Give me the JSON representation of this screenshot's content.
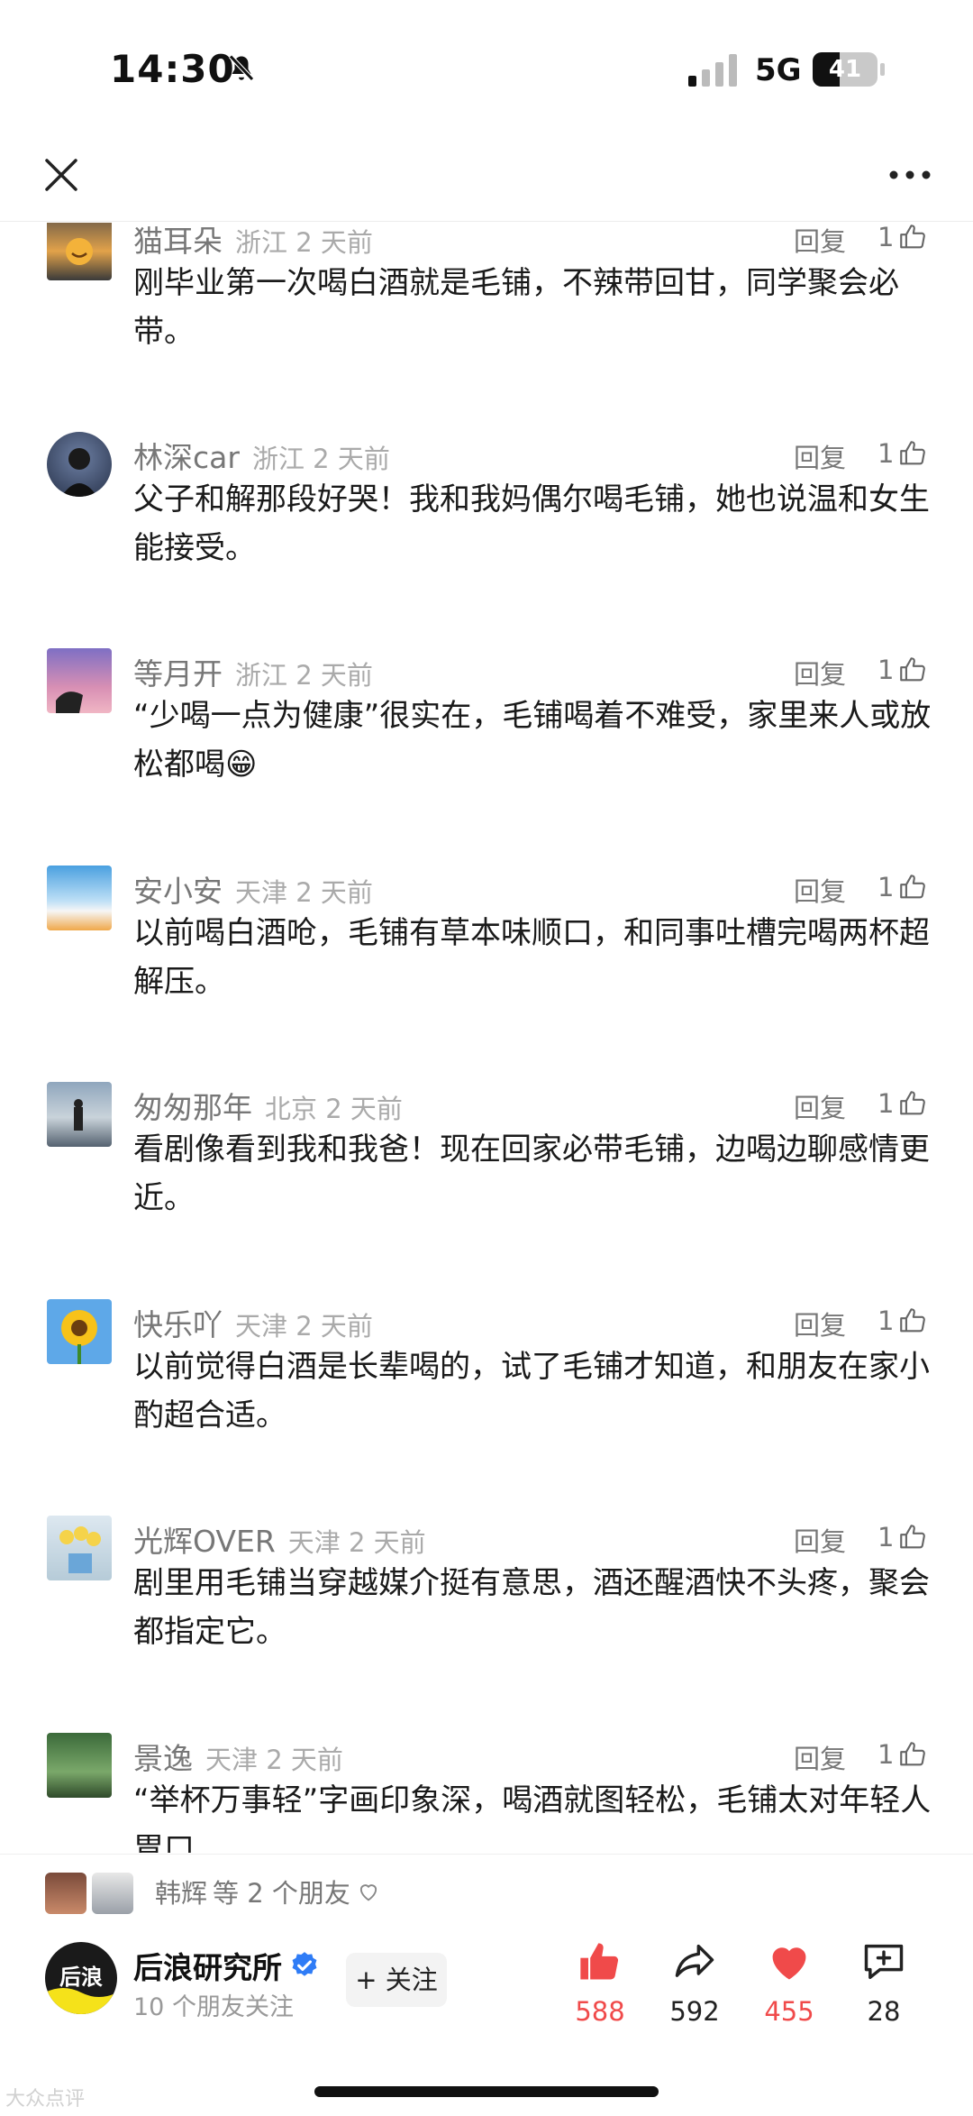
{
  "status": {
    "time": "14:30",
    "network": "5G",
    "battery": "41",
    "battery_level": 0.41
  },
  "comments": [
    {
      "user": "猫耳朵",
      "meta": "浙江 2 天前",
      "text": "刚毕业第一次喝白酒就是毛铺，不辣带回甘，同学聚会必带。",
      "reply": "回复",
      "likes": "1"
    },
    {
      "user": "林深car",
      "meta": "浙江 2 天前",
      "text": "父子和解那段好哭！我和我妈偶尔喝毛铺，她也说温和女生能接受。",
      "reply": "回复",
      "likes": "1"
    },
    {
      "user": "等月开",
      "meta": "浙江 2 天前",
      "text": "“少喝一点为健康”很实在，毛铺喝着不难受，家里来人或放松都喝😁",
      "reply": "回复",
      "likes": "1"
    },
    {
      "user": "安小安",
      "meta": "天津 2 天前",
      "text": "以前喝白酒呛，毛铺有草本味顺口，和同事吐槽完喝两杯超解压。",
      "reply": "回复",
      "likes": "1"
    },
    {
      "user": "匆匆那年",
      "meta": "北京 2 天前",
      "text": "看剧像看到我和我爸！现在回家必带毛铺，边喝边聊感情更近。",
      "reply": "回复",
      "likes": "1"
    },
    {
      "user": "快乐吖",
      "meta": "天津 2 天前",
      "text": "以前觉得白酒是长辈喝的，试了毛铺才知道，和朋友在家小酌超合适。",
      "reply": "回复",
      "likes": "1"
    },
    {
      "user": "光辉OVER",
      "meta": "天津 2 天前",
      "text": "剧里用毛铺当穿越媒介挺有意思，酒还醒酒快不头疼，聚会都指定它。",
      "reply": "回复",
      "likes": "1"
    },
    {
      "user": "景逸",
      "meta": "天津 2 天前",
      "text": "“举杯万事轻”字画印象深，喝酒就图轻松，毛铺太对年轻人胃口",
      "reply": "回复",
      "likes": "1"
    }
  ],
  "friends": {
    "name": "韩辉",
    "suffix": "等 2 个朋友"
  },
  "author": {
    "name": "后浪研究所",
    "sub": "10 个朋友关注",
    "follow": "+ 关注",
    "logo": "后浪"
  },
  "actions": {
    "like": "588",
    "share": "592",
    "favorite": "455",
    "comment": "28"
  },
  "watermark": "大众点评",
  "colors": {
    "accent_red": "#f04a4a",
    "verified_blue": "#2f7cf6"
  }
}
